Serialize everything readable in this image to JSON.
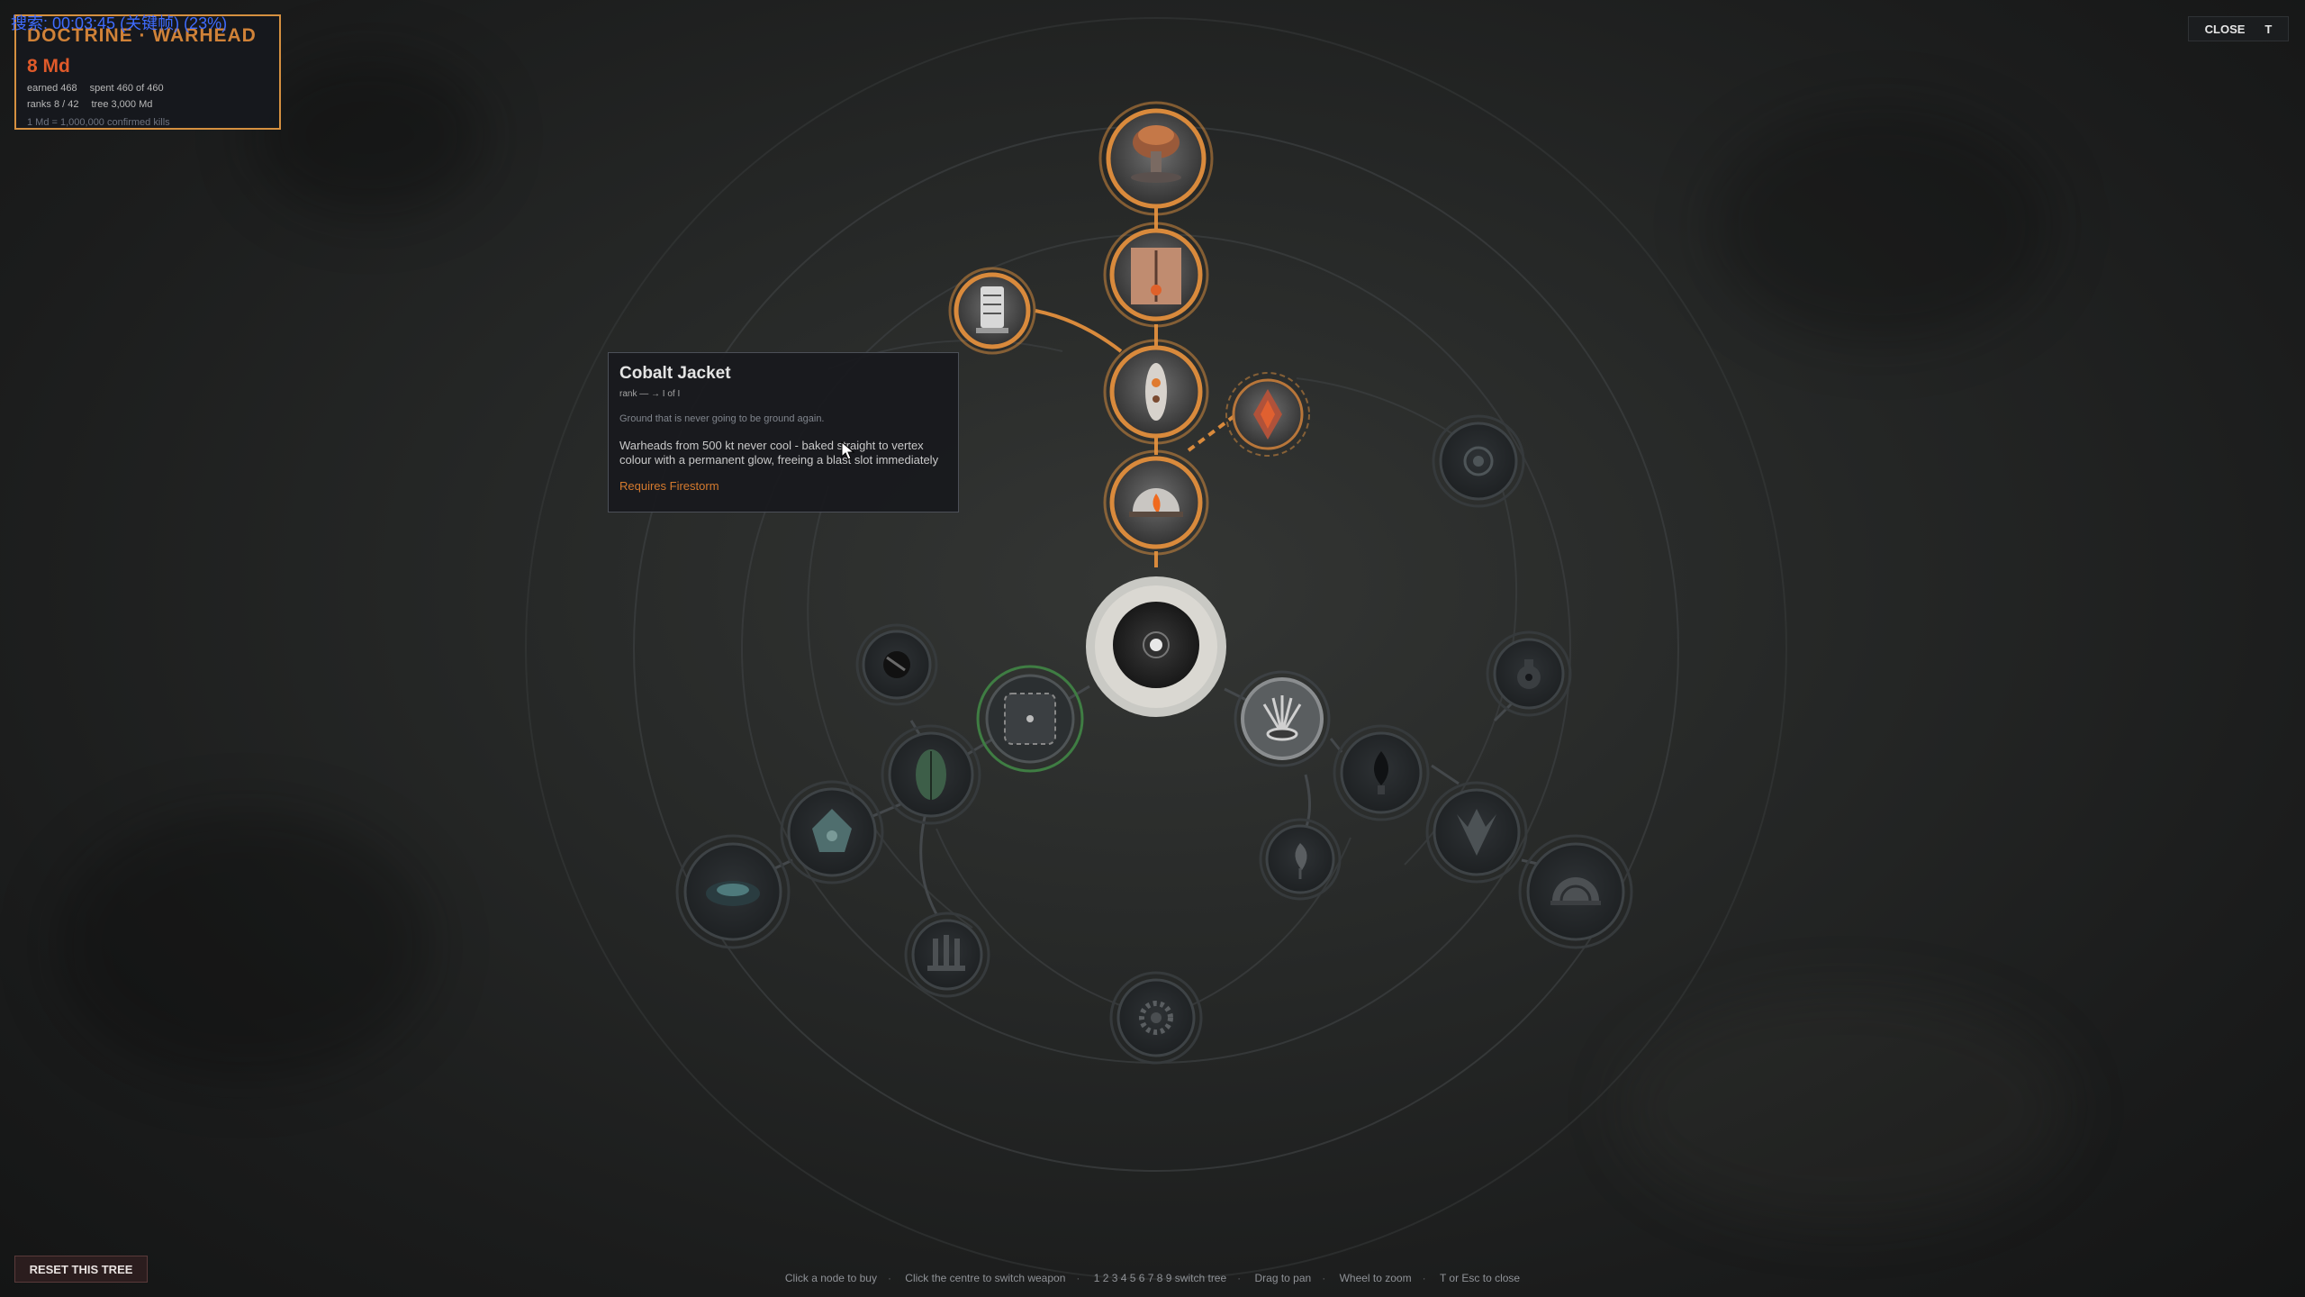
{
  "debug_overlay": "搜索: 00:03:45 (关键帧) (23%)",
  "panel": {
    "title": "DOCTRINE · WARHEAD",
    "currency": "8 Md",
    "earned": "earned 468",
    "spent": "spent 460 of 460",
    "ranks": "ranks 8 / 42",
    "tree": "tree 3,000 Md",
    "conversion": "1 Md = 1,000,000 confirmed kills"
  },
  "close_button": {
    "label": "CLOSE",
    "key": "T"
  },
  "tooltip": {
    "title": "Cobalt Jacket",
    "rank": "rank — → I of I",
    "flavor": "Ground that is never going to be ground again.",
    "description": "Warheads from 500 kt never cool - baked straight to vertex colour with a permanent glow, freeing a blast slot immediately",
    "requirement": "Requires Firestorm"
  },
  "reset_button": {
    "label": "RESET THIS TREE"
  },
  "hints": [
    "Click a node to buy",
    "Click the centre to switch weapon",
    "1 2 3 4 5 6 7 8 9 switch tree",
    "Drag to pan",
    "Wheel to zoom",
    "T or Esc to close"
  ],
  "nodes": [
    {
      "id": "mushroom-cloud",
      "state": "owned",
      "icon": "mushroom-cloud-icon"
    },
    {
      "id": "blast-door",
      "state": "owned",
      "icon": "door-icon"
    },
    {
      "id": "canister",
      "state": "owned",
      "icon": "canister-icon"
    },
    {
      "id": "warhead-core",
      "state": "owned",
      "icon": "warhead-icon"
    },
    {
      "id": "firestorm",
      "state": "owned",
      "icon": "flame-dome-icon"
    },
    {
      "id": "cobalt-jacket",
      "state": "available",
      "icon": "crystal-icon"
    },
    {
      "id": "weapon-centre",
      "state": "centre",
      "icon": "target-icon"
    },
    {
      "id": "fan-burst",
      "state": "locked",
      "icon": "fan-icon"
    },
    {
      "id": "grid-chip",
      "state": "available-green",
      "icon": "chip-icon"
    },
    {
      "id": "leaf",
      "state": "locked",
      "icon": "leaf-icon"
    },
    {
      "id": "orb-left",
      "state": "locked",
      "icon": "orb-icon"
    },
    {
      "id": "cell",
      "state": "locked",
      "icon": "cell-icon"
    },
    {
      "id": "crater",
      "state": "locked",
      "icon": "crater-icon"
    },
    {
      "id": "pillars",
      "state": "locked",
      "icon": "pillars-icon"
    },
    {
      "id": "radial",
      "state": "locked",
      "icon": "radial-icon"
    },
    {
      "id": "drop",
      "state": "locked",
      "icon": "drop-icon"
    },
    {
      "id": "pin",
      "state": "locked",
      "icon": "pin-icon"
    },
    {
      "id": "spike",
      "state": "locked",
      "icon": "spike-icon"
    },
    {
      "id": "dome",
      "state": "locked",
      "icon": "dome-icon"
    },
    {
      "id": "eye",
      "state": "locked",
      "icon": "eye-icon"
    },
    {
      "id": "flask",
      "state": "locked",
      "icon": "flask-icon"
    }
  ],
  "colors": {
    "accent": "#d98a3c",
    "owned_ring": "#e0913f",
    "green_ring": "#3f7d43",
    "danger": "#e05a2a"
  }
}
